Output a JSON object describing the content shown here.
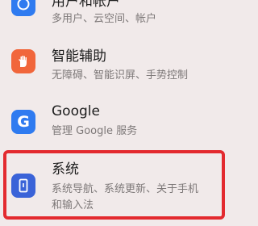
{
  "settings_list": {
    "items": [
      {
        "title": "用户和帐户",
        "subtitle": "多用户、云空间、帐户",
        "icon": "user-icon",
        "icon_color": "#2f7bf0"
      },
      {
        "title": "智能辅助",
        "subtitle": "无障碍、智能识屏、手势控制",
        "icon": "hand-icon",
        "icon_color": "#f1663b"
      },
      {
        "title": "Google",
        "subtitle": "管理 Google 服务",
        "icon": "google-icon",
        "icon_color": "#2f7bf0"
      },
      {
        "title": "系统",
        "subtitle": "系统导航、系统更新、关于手机",
        "subtitle_line2": "和输入法",
        "icon": "phone-icon",
        "icon_color": "#3a63d8"
      }
    ],
    "highlight_color": "#e32a2f"
  }
}
